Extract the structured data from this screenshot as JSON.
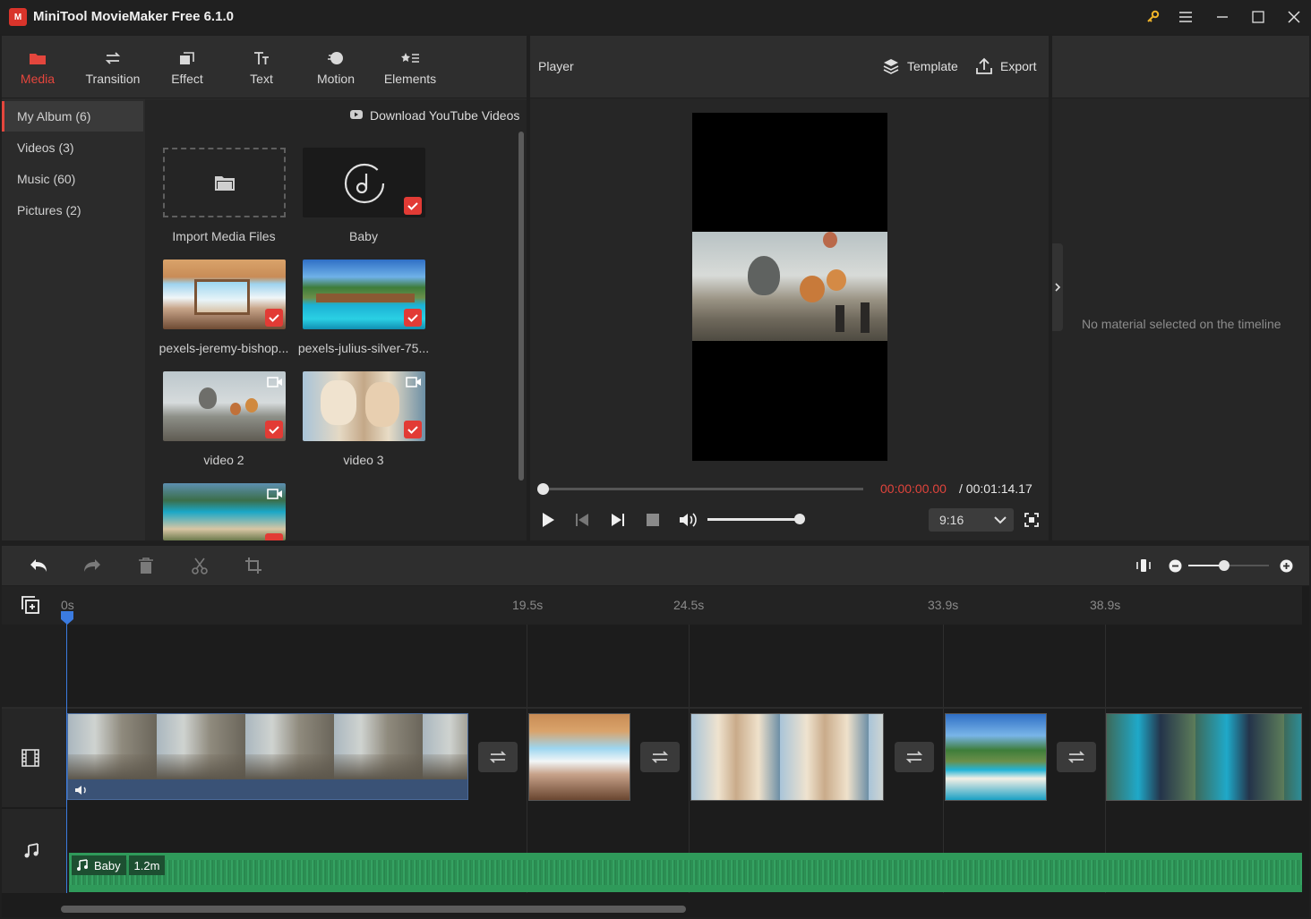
{
  "app": {
    "title": "MiniTool MovieMaker Free 6.1.0",
    "logo_text": "M"
  },
  "toolbar": {
    "tabs": [
      {
        "label": "Media",
        "icon": "folder-icon",
        "active": true
      },
      {
        "label": "Transition",
        "icon": "swap-icon"
      },
      {
        "label": "Effect",
        "icon": "effect-icon"
      },
      {
        "label": "Text",
        "icon": "text-icon"
      },
      {
        "label": "Motion",
        "icon": "motion-icon"
      },
      {
        "label": "Elements",
        "icon": "elements-icon"
      }
    ]
  },
  "album": {
    "items": [
      {
        "label": "My Album (6)",
        "active": true
      },
      {
        "label": "Videos (3)"
      },
      {
        "label": "Music (60)"
      },
      {
        "label": "Pictures (2)"
      }
    ],
    "download_label": "Download YouTube Videos"
  },
  "media": {
    "import_label": "Import Media Files",
    "items": [
      {
        "label": "Baby"
      },
      {
        "label": "pexels-jeremy-bishop..."
      },
      {
        "label": "pexels-julius-silver-75..."
      },
      {
        "label": "video 2"
      },
      {
        "label": "video 3"
      }
    ]
  },
  "player": {
    "title": "Player",
    "template_label": "Template",
    "export_label": "Export",
    "current_time": "00:00:00.00",
    "total_time": "/ 00:01:14.17",
    "aspect": "9:16",
    "progress": 0,
    "volume": 1.0
  },
  "properties": {
    "empty_text": "No material selected on the timeline"
  },
  "timeline": {
    "ticks": [
      "0s",
      "19.5s",
      "24.5s",
      "33.9s",
      "38.9s"
    ],
    "zoom": 0.6,
    "audio_clip": {
      "name": "Baby",
      "duration": "1.2m"
    }
  },
  "colors": {
    "accent": "#e4463d",
    "audio": "#2f9a5a",
    "playhead": "#3b7be0",
    "time_red": "#e0443c"
  }
}
